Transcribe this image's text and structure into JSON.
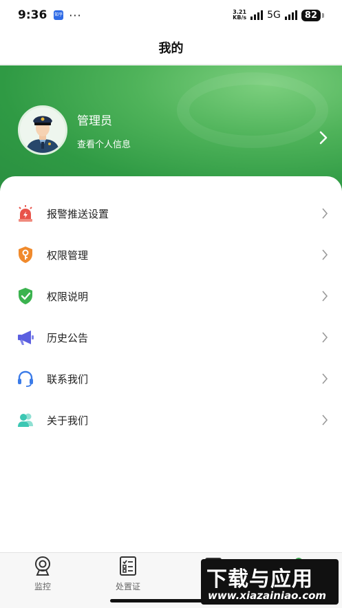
{
  "status_bar": {
    "time": "9:36",
    "app_badge": "知乎",
    "dots": "···",
    "speed_top": "3.21",
    "speed_bottom": "KB/s",
    "network": "5G",
    "battery": "82"
  },
  "header": {
    "title": "我的"
  },
  "profile": {
    "name": "管理员",
    "subtitle": "查看个人信息"
  },
  "menu": [
    {
      "label": "报警推送设置",
      "icon": "alarm-light-icon",
      "color": "#e8534a"
    },
    {
      "label": "权限管理",
      "icon": "shield-key-icon",
      "color": "#f08a2c"
    },
    {
      "label": "权限说明",
      "icon": "shield-check-icon",
      "color": "#3bb34f"
    },
    {
      "label": "历史公告",
      "icon": "megaphone-icon",
      "color": "#5b5fe0"
    },
    {
      "label": "联系我们",
      "icon": "headset-icon",
      "color": "#3b7be8"
    },
    {
      "label": "关于我们",
      "icon": "users-icon",
      "color": "#3cc7b3"
    }
  ],
  "tabs": [
    {
      "label": "监控",
      "icon": "camera-icon"
    },
    {
      "label": "处置证",
      "icon": "checklist-icon"
    },
    {
      "label": "",
      "icon": "chart-icon"
    },
    {
      "label": "",
      "icon": "person-icon"
    }
  ],
  "watermark": {
    "line1": "下载与应用",
    "line2": "www.xiazainiao.com"
  },
  "colors": {
    "accent": "#3da44e",
    "banner": "#2f9a44"
  }
}
